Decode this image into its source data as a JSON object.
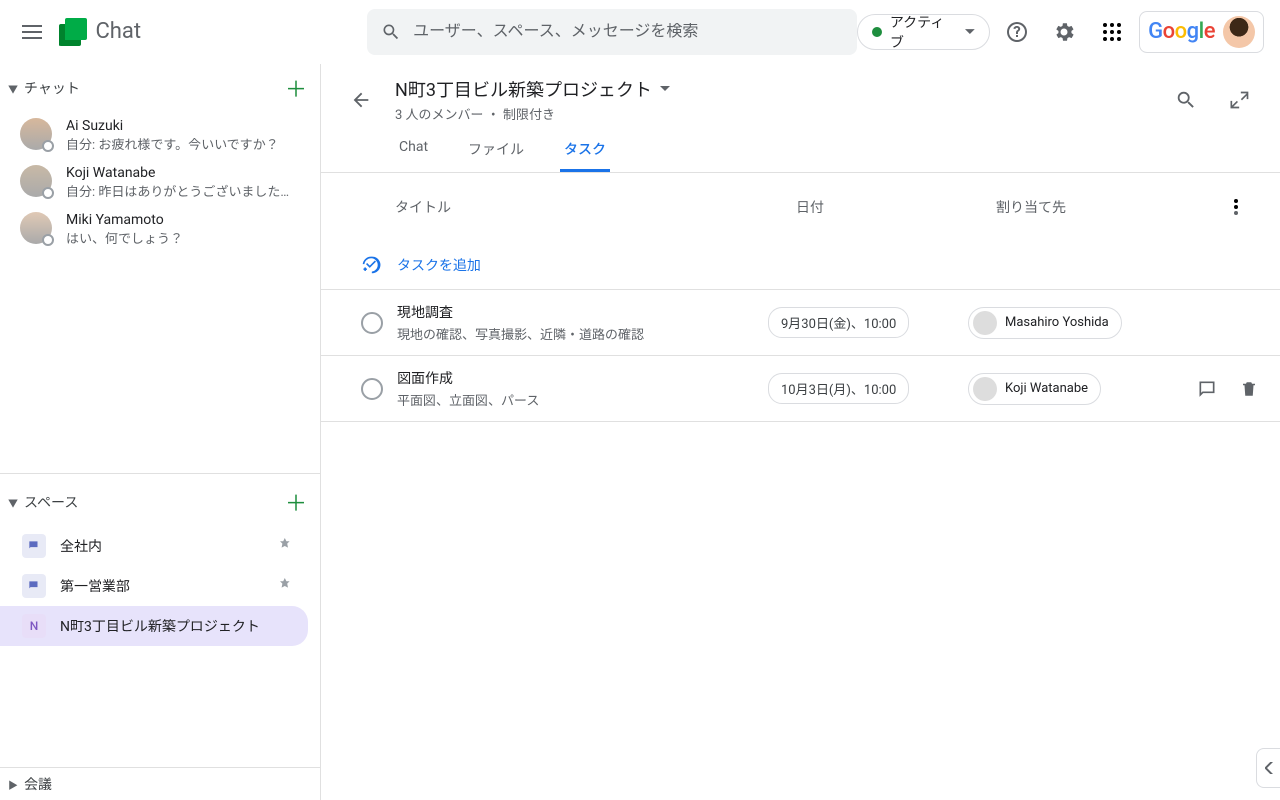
{
  "header": {
    "app_name": "Chat",
    "search_placeholder": "ユーザー、スペース、メッセージを検索",
    "active_label": "アクティブ"
  },
  "sidebar": {
    "chats": {
      "title": "チャット",
      "items": [
        {
          "name": "Ai Suzuki",
          "preview": "自分: お疲れ様です。今いいですか？"
        },
        {
          "name": "Koji Watanabe",
          "preview": "自分: 昨日はありがとうございました…"
        },
        {
          "name": "Miki Yamamoto",
          "preview": "はい、何でしょう？"
        }
      ]
    },
    "spaces": {
      "title": "スペース",
      "items": [
        {
          "name": "全社内",
          "icon_type": "forum",
          "pinned": true
        },
        {
          "name": "第一営業部",
          "icon_type": "forum",
          "pinned": true
        },
        {
          "name": "N町3丁目ビル新築プロジェクト",
          "icon_type": "letter",
          "letter": "N",
          "active": true
        }
      ]
    },
    "meetings": {
      "title": "会議"
    }
  },
  "main": {
    "space_title": "N町3丁目ビル新築プロジェクト",
    "space_subtitle": "3 人のメンバー ・ 制限付き",
    "tabs": [
      {
        "label": "Chat"
      },
      {
        "label": "ファイル"
      },
      {
        "label": "タスク"
      }
    ],
    "active_tab": 2,
    "columns": {
      "title": "タイトル",
      "date": "日付",
      "assign": "割り当て先"
    },
    "add_task_label": "タスクを追加",
    "tasks": [
      {
        "title": "現地調査",
        "desc": "現地の確認、写真撮影、近隣・道路の確認",
        "date": "9月30日(金)、10:00",
        "assignee": "Masahiro Yoshida",
        "hover": false
      },
      {
        "title": "図面作成",
        "desc": "平面図、立面図、パース",
        "date": "10月3日(月)、10:00",
        "assignee": "Koji Watanabe",
        "hover": true
      }
    ]
  }
}
